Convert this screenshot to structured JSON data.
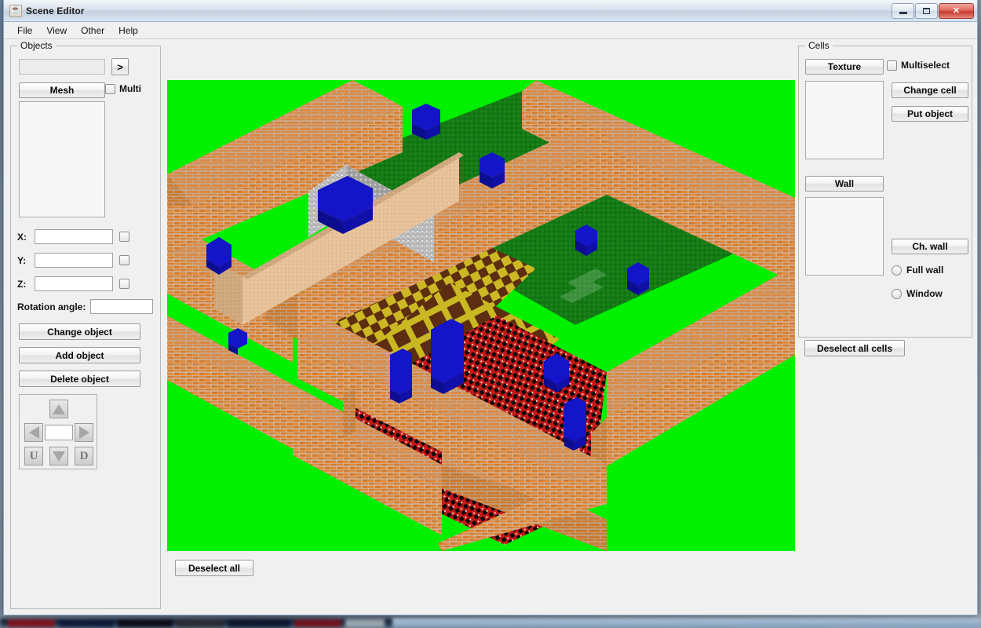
{
  "window": {
    "title": "Scene Editor",
    "app_icon": "java-coffee-cup-icon",
    "controls": {
      "minimize": "minimize-icon",
      "maximize": "maximize-icon",
      "close": "✕"
    }
  },
  "menu": {
    "items": [
      {
        "label": "File"
      },
      {
        "label": "View"
      },
      {
        "label": "Other"
      },
      {
        "label": "Help"
      }
    ]
  },
  "objects_panel": {
    "title": "Objects",
    "name_field": {
      "value": "",
      "placeholder": ""
    },
    "go_button": ">",
    "mesh_button": "Mesh",
    "multi_checkbox": {
      "label": "Multi",
      "checked": false
    },
    "mesh_list": {
      "items": []
    },
    "coords": [
      {
        "label": "X:",
        "value": "",
        "locked": false
      },
      {
        "label": "Y:",
        "value": "",
        "locked": false
      },
      {
        "label": "Z:",
        "value": "",
        "locked": false
      }
    ],
    "rotation": {
      "label": "Rotation angle:",
      "value": ""
    },
    "buttons": [
      {
        "label": "Change object"
      },
      {
        "label": "Add object"
      },
      {
        "label": "Delete object"
      }
    ],
    "dpad": {
      "up": "arrow-up-icon",
      "left": "arrow-left-icon",
      "right": "arrow-right-icon",
      "down": "arrow-down-icon",
      "u_button": "U",
      "d_button": "D",
      "step_value": ""
    }
  },
  "cells_panel": {
    "title": "Cells",
    "texture_button": "Texture",
    "multiselect_checkbox": {
      "label": "Multiselect",
      "checked": false
    },
    "texture_list": {
      "items": []
    },
    "change_cell_button": "Change cell",
    "put_object_button": "Put object",
    "wall_button": "Wall",
    "wall_list": {
      "items": []
    },
    "ch_wall_button": "Ch. wall",
    "wall_type_radios": [
      {
        "label": "Full wall",
        "selected": false
      },
      {
        "label": "Window",
        "selected": false
      }
    ],
    "deselect_all_cells_button": "Deselect all cells"
  },
  "viewport": {
    "name": "scene-3d-render",
    "deselect_all_button": "Deselect all",
    "background_color": "#00f000",
    "palette": {
      "grass_green": "#1a7a1a",
      "brick_orange": "#e08a3c",
      "brick_orange_dark": "#c4702c",
      "brick_shadow": "#b0642a",
      "checker_yellow": "#ccbb22",
      "checker_brown": "#5a2d10",
      "red_floor": "#cc1f1f",
      "stone_gray": "#b8b8b8",
      "sand_tan": "#e8c49a",
      "object_blue": "#1414c8",
      "object_blue_dark": "#0d0d8f"
    },
    "objects_count": 11
  }
}
